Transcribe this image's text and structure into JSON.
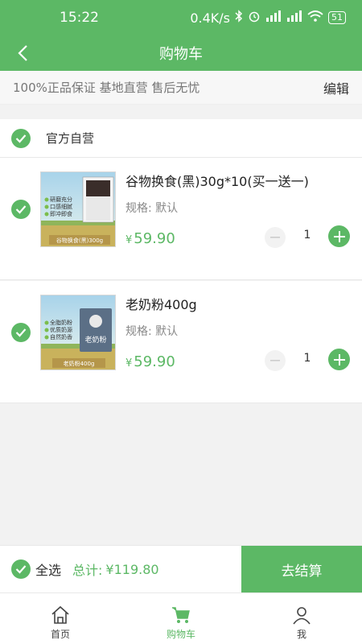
{
  "status_bar": {
    "time": "15:22",
    "speed": "0.4K/s",
    "battery": "51"
  },
  "header": {
    "title": "购物车"
  },
  "guarantee": {
    "text": "100%正品保证 基地直营 售后无忧",
    "edit_label": "编辑"
  },
  "shop": {
    "name": "官方自营"
  },
  "items": [
    {
      "title": "谷物换食(黑)30g*10(买一送一)",
      "spec": "规格: 默认",
      "price_symbol": "¥",
      "price": "59.90",
      "quantity": "1",
      "image_label": "谷物换食(黑)300g",
      "image_bullets": [
        "研磨充分",
        "口感细腻",
        "即冲即食"
      ]
    },
    {
      "title": "老奶粉400g",
      "spec": "规格: 默认",
      "price_symbol": "¥",
      "price": "59.90",
      "quantity": "1",
      "image_label": "老奶粉400g",
      "image_bullets": [
        "全脂奶粉",
        "优质奶源",
        "自然奶香"
      ],
      "image_pack_text": "老奶粉"
    }
  ],
  "checkout": {
    "select_all_label": "全选",
    "total_label": "总计:",
    "total_value": "¥119.80",
    "settle_label": "去结算"
  },
  "tabbar": {
    "tabs": [
      {
        "label": "首页",
        "icon": "home-icon",
        "active": false
      },
      {
        "label": "购物车",
        "icon": "cart-icon",
        "active": true
      },
      {
        "label": "我",
        "icon": "user-icon",
        "active": false
      }
    ]
  },
  "colors": {
    "accent": "#5cb865"
  }
}
